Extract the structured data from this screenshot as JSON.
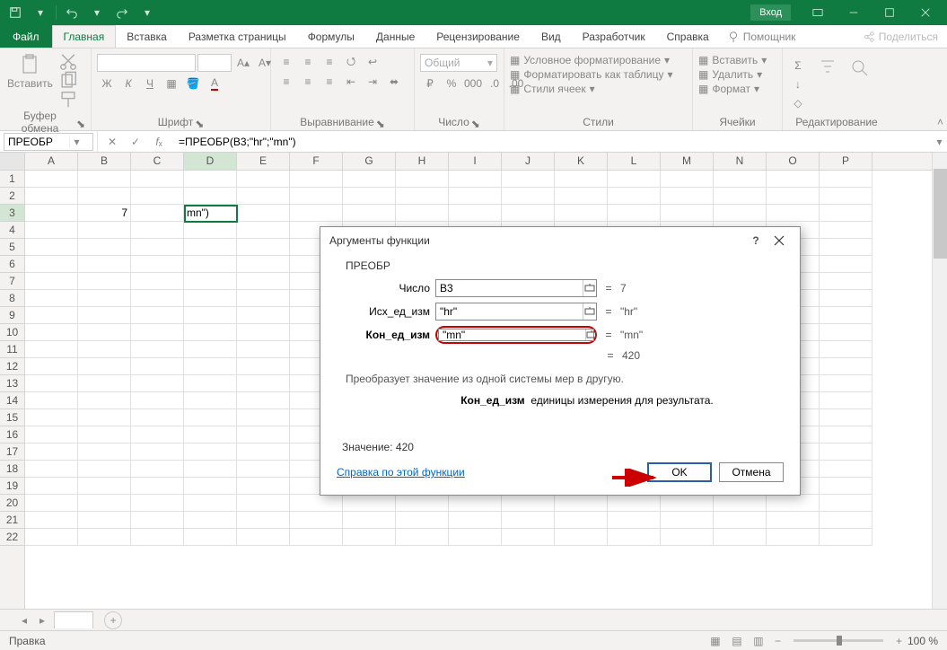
{
  "titlebar": {
    "login": "Вход"
  },
  "menu": {
    "file": "Файл",
    "tabs": [
      "Главная",
      "Вставка",
      "Разметка страницы",
      "Формулы",
      "Данные",
      "Рецензирование",
      "Вид",
      "Разработчик",
      "Справка"
    ],
    "tell_me": "Помощник",
    "share": "Поделиться"
  },
  "ribbon": {
    "clipboard": {
      "label": "Буфер обмена",
      "paste": "Вставить"
    },
    "font": {
      "label": "Шрифт"
    },
    "alignment": {
      "label": "Выравнивание"
    },
    "number": {
      "label": "Число",
      "format": "Общий"
    },
    "styles": {
      "label": "Стили",
      "cond": "Условное форматирование",
      "table": "Форматировать как таблицу",
      "cell": "Стили ячеек"
    },
    "cells": {
      "label": "Ячейки",
      "insert": "Вставить",
      "delete": "Удалить",
      "format": "Формат"
    },
    "editing": {
      "label": "Редактирование"
    }
  },
  "namebox": "ПРЕОБР",
  "formula": "=ПРЕОБР(B3;\"hr\";\"mn\")",
  "columns": [
    "A",
    "B",
    "C",
    "D",
    "E",
    "F",
    "G",
    "H",
    "I",
    "J",
    "K",
    "L",
    "M",
    "N",
    "O",
    "P"
  ],
  "rows": [
    "1",
    "2",
    "3",
    "4",
    "5",
    "6",
    "7",
    "8",
    "9",
    "10",
    "11",
    "12",
    "13",
    "14",
    "15",
    "16",
    "17",
    "18",
    "19",
    "20",
    "21",
    "22"
  ],
  "cell_b3": "7",
  "cell_d3": "mn\")",
  "dialog": {
    "title": "Аргументы функции",
    "fn": "ПРЕОБР",
    "args": [
      {
        "label": "Число",
        "value": "B3",
        "result": "7",
        "bold": false
      },
      {
        "label": "Исх_ед_изм",
        "value": "\"hr\"",
        "result": "\"hr\"",
        "bold": false
      },
      {
        "label": "Кон_ед_изм",
        "value": "\"mn\"",
        "result": "\"mn\"",
        "bold": true
      }
    ],
    "final_result": "420",
    "desc": "Преобразует значение из одной системы мер в другую.",
    "arg_help_label": "Кон_ед_изм",
    "arg_help_text": "единицы измерения для результата.",
    "value_label": "Значение:",
    "value": "420",
    "help_link": "Справка по этой функции",
    "ok": "OK",
    "cancel": "Отмена"
  },
  "status": {
    "mode": "Правка",
    "zoom": "100 %"
  }
}
